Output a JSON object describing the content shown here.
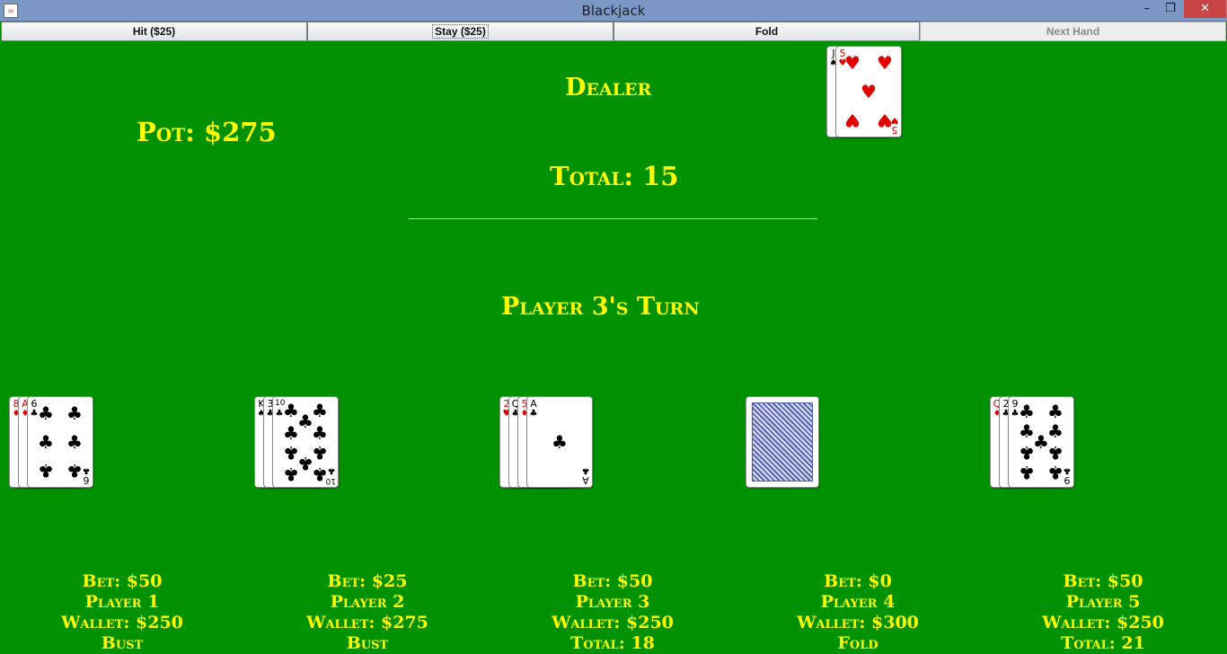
{
  "window": {
    "title": "Blackjack",
    "app_icon": "java-icon"
  },
  "toolbar": {
    "hit": "Hit ($25)",
    "stay": "Stay ($25)",
    "fold": "Fold",
    "next_hand": "Next Hand"
  },
  "table": {
    "dealer_label": "Dealer",
    "pot": "Pot: $275",
    "dealer_total": "Total: 15",
    "turn": "Player 3's Turn"
  },
  "dealer": {
    "cards": [
      {
        "rank": "J",
        "suit": "♠"
      },
      {
        "rank": "5",
        "suit": "♥"
      }
    ]
  },
  "players": [
    {
      "bet": "Bet: $50",
      "name": "Player 1",
      "wallet": "Wallet: $250",
      "status": "Bust",
      "cards": [
        {
          "rank": "8",
          "suit": "♦"
        },
        {
          "rank": "A",
          "suit": "♦"
        },
        {
          "rank": "6",
          "suit": "♣"
        }
      ]
    },
    {
      "bet": "Bet: $25",
      "name": "Player 2",
      "wallet": "Wallet: $275",
      "status": "Bust",
      "cards": [
        {
          "rank": "K",
          "suit": "♠"
        },
        {
          "rank": "3",
          "suit": "♣"
        },
        {
          "rank": "10",
          "suit": "♣"
        }
      ]
    },
    {
      "bet": "Bet: $50",
      "name": "Player 3",
      "wallet": "Wallet: $250",
      "status": "Total: 18",
      "cards": [
        {
          "rank": "2",
          "suit": "♥"
        },
        {
          "rank": "Q",
          "suit": "♣"
        },
        {
          "rank": "5",
          "suit": "♦"
        },
        {
          "rank": "A",
          "suit": "♣"
        }
      ]
    },
    {
      "bet": "Bet: $0",
      "name": "Player 4",
      "wallet": "Wallet: $300",
      "status": "Fold",
      "cards": []
    },
    {
      "bet": "Bet: $50",
      "name": "Player 5",
      "wallet": "Wallet: $250",
      "status": "Total: 21",
      "cards": [
        {
          "rank": "Q",
          "suit": "♦"
        },
        {
          "rank": "2",
          "suit": "♣"
        },
        {
          "rank": "9",
          "suit": "♣"
        }
      ]
    }
  ],
  "colors": {
    "felt": "#009100",
    "text": "#ffff00",
    "titlebar": "#7a97c6",
    "close": "#c74545"
  }
}
